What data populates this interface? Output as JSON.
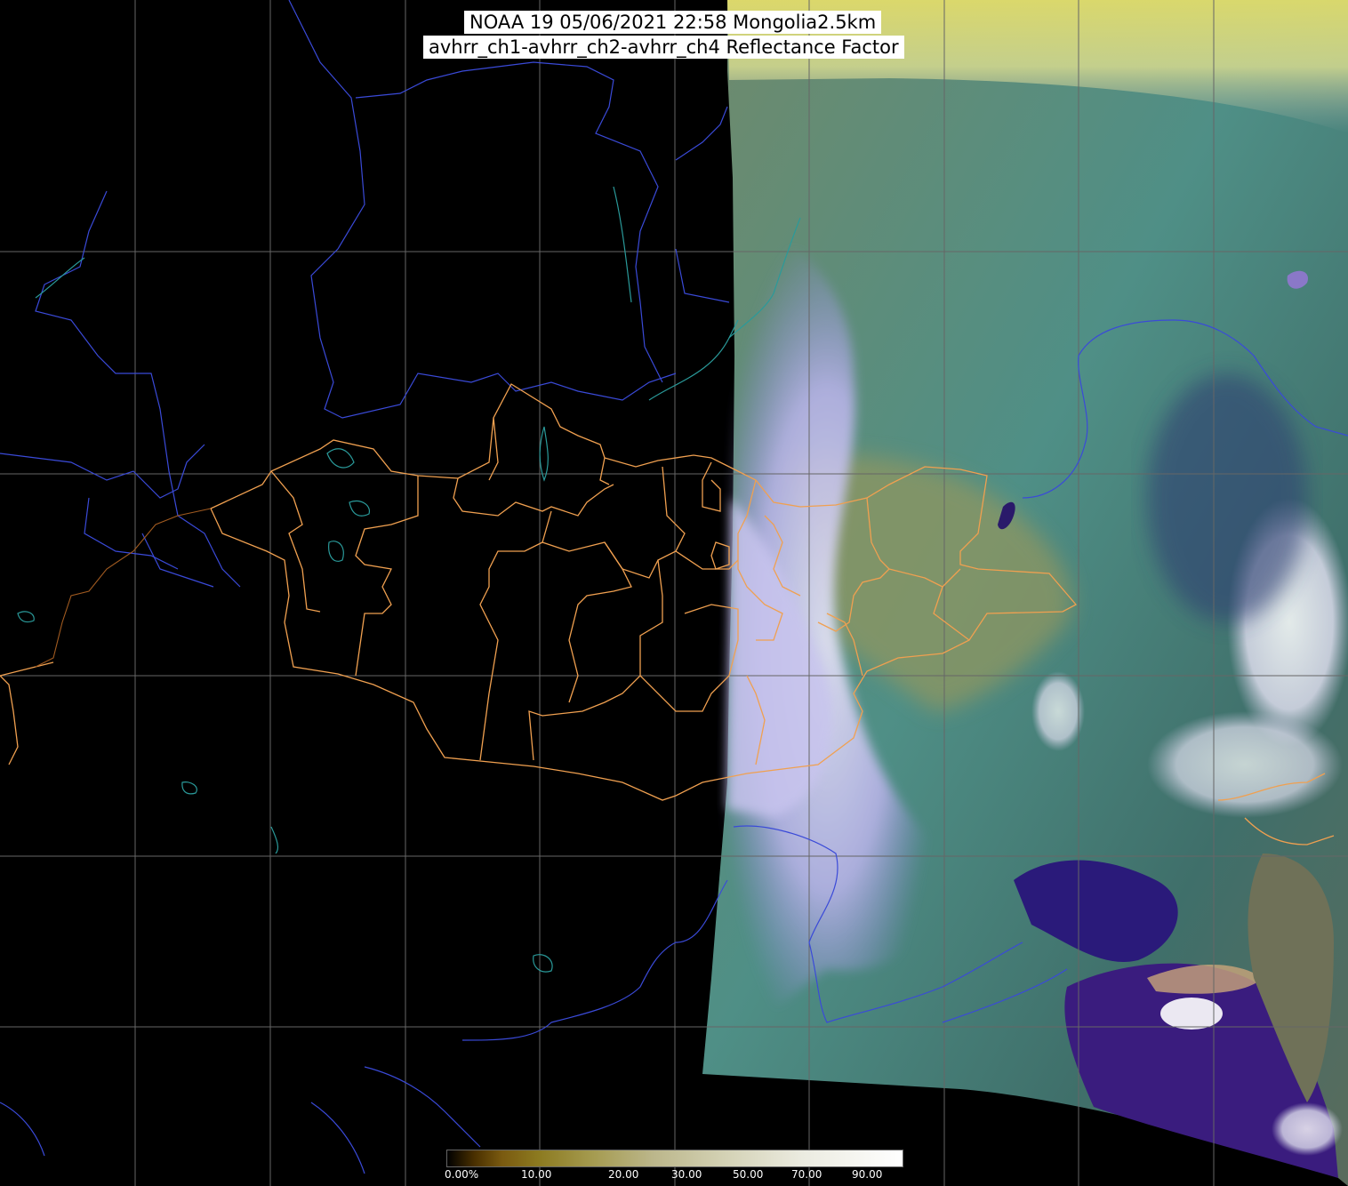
{
  "header": {
    "line1": "NOAA 19 05/06/2021 22:58 Mongolia2.5km",
    "line2": "avhrr_ch1-avhrr_ch2-avhrr_ch4 Reflectance Factor"
  },
  "colorbar": {
    "labels": [
      "0.00%",
      "10.00",
      "20.00",
      "30.00",
      "50.00",
      "70.00",
      "90.00"
    ]
  },
  "colors": {
    "grid": "#666666",
    "coast_rivers": "#3a4ad8",
    "lakes_coast": "#2a8a8a",
    "admin_borders": "#f0a050",
    "background": "#000000"
  }
}
